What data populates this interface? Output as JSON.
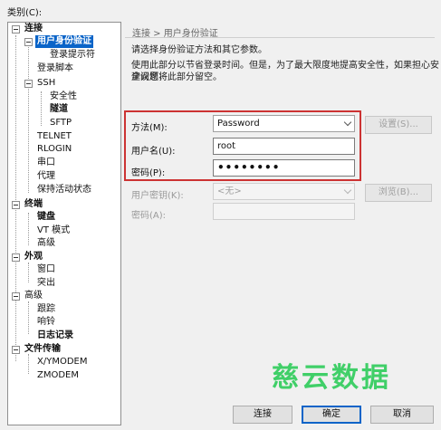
{
  "category_label": "类别(C):",
  "tree": [
    {
      "label": "连接",
      "bold": true
    },
    {
      "label": "用户身份验证",
      "bold": true,
      "selected": true
    },
    {
      "label": "登录提示符"
    },
    {
      "label": "登录脚本"
    },
    {
      "label": "SSH"
    },
    {
      "label": "安全性"
    },
    {
      "label": "隧道",
      "bold": true
    },
    {
      "label": "SFTP"
    },
    {
      "label": "TELNET"
    },
    {
      "label": "RLOGIN"
    },
    {
      "label": "串口"
    },
    {
      "label": "代理"
    },
    {
      "label": "保持活动状态"
    },
    {
      "label": "终端",
      "bold": true
    },
    {
      "label": "键盘",
      "bold": true
    },
    {
      "label": "VT 模式"
    },
    {
      "label": "高级"
    },
    {
      "label": "外观",
      "bold": true
    },
    {
      "label": "窗口"
    },
    {
      "label": "突出"
    },
    {
      "label": "高级"
    },
    {
      "label": "跟踪"
    },
    {
      "label": "响铃"
    },
    {
      "label": "日志记录",
      "bold": true
    },
    {
      "label": "文件传输",
      "bold": true
    },
    {
      "label": "X/YMODEM"
    },
    {
      "label": "ZMODEM"
    }
  ],
  "breadcrumb": "连接 > 用户身份验证",
  "description": [
    "请选择身份验证方法和其它参数。",
    "使用此部分以节省登录时间。但是，为了最大限度地提高安全性，如果担心安全问题，",
    "建议您将此部分留空。"
  ],
  "form": {
    "method_label": "方法(M):",
    "method_value": "Password",
    "username_label": "用户名(U):",
    "username_value": "root",
    "password_label": "密码(P):",
    "password_value": "••••••••",
    "userkey_label": "用户密钥(K):",
    "userkey_value": "<无>",
    "passphrase_label": "密码(A):",
    "settings_button": "设置(S)...",
    "browse_button": "浏览(B)..."
  },
  "buttons": {
    "connect": "连接",
    "ok": "确定",
    "cancel": "取消"
  },
  "watermark": "慈云数据",
  "colors": {
    "selection": "#0a64c8",
    "highlight_border": "#cc3333",
    "watermark": "#2ecc5a"
  }
}
